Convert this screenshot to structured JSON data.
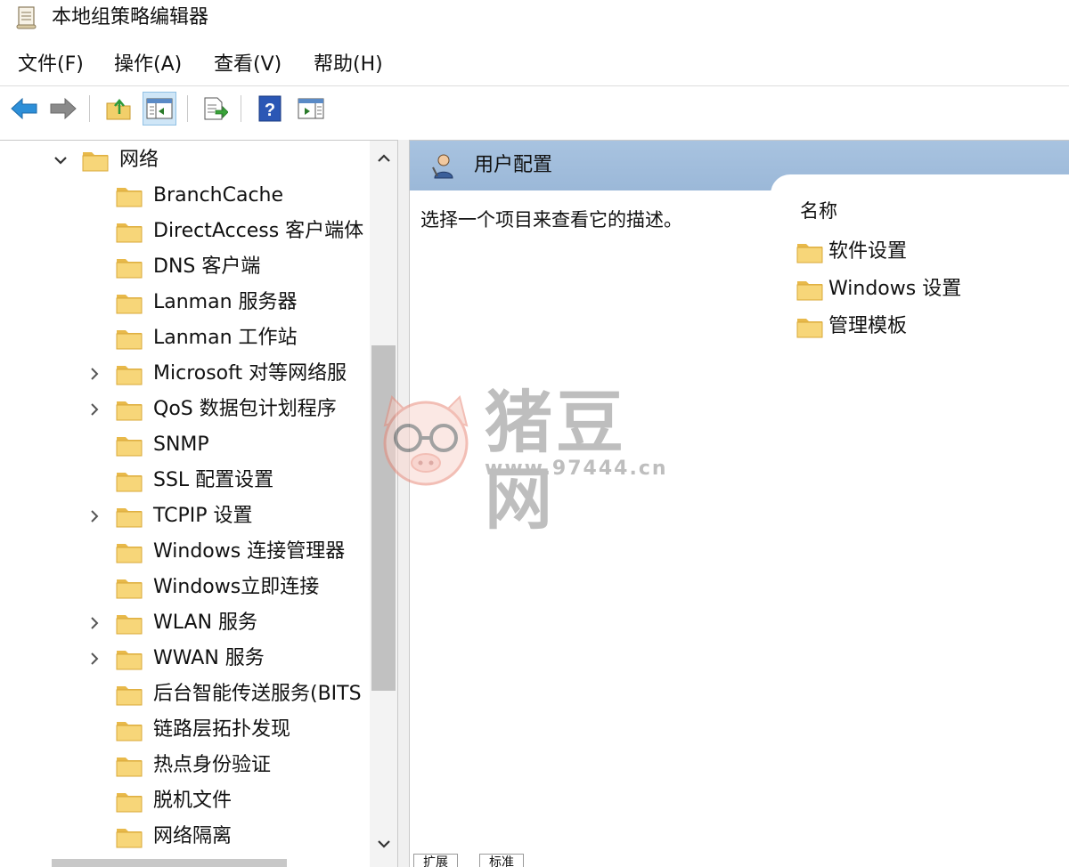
{
  "window": {
    "title": "本地组策略编辑器"
  },
  "menu": [
    {
      "label": "文件(F)"
    },
    {
      "label": "操作(A)"
    },
    {
      "label": "查看(V)"
    },
    {
      "label": "帮助(H)"
    }
  ],
  "toolbar": {
    "buttons": [
      "back-arrow-icon",
      "forward-arrow-icon",
      "up-folder-icon",
      "show-hide-tree-icon",
      "export-list-icon",
      "help-icon",
      "show-action-pane-icon"
    ],
    "active": "show-hide-tree-icon"
  },
  "tree": {
    "items": [
      {
        "label": "网络",
        "expander": "expanded"
      },
      {
        "label": "BranchCache",
        "expander": "none"
      },
      {
        "label": "DirectAccess 客户端体",
        "expander": "none"
      },
      {
        "label": "DNS 客户端",
        "expander": "none"
      },
      {
        "label": "Lanman 服务器",
        "expander": "none"
      },
      {
        "label": "Lanman 工作站",
        "expander": "none"
      },
      {
        "label": "Microsoft 对等网络服",
        "expander": "collapsed"
      },
      {
        "label": "QoS 数据包计划程序",
        "expander": "collapsed"
      },
      {
        "label": "SNMP",
        "expander": "none"
      },
      {
        "label": "SSL 配置设置",
        "expander": "none"
      },
      {
        "label": "TCPIP 设置",
        "expander": "collapsed"
      },
      {
        "label": "Windows 连接管理器",
        "expander": "none"
      },
      {
        "label": "Windows立即连接",
        "expander": "none"
      },
      {
        "label": "WLAN 服务",
        "expander": "collapsed"
      },
      {
        "label": "WWAN 服务",
        "expander": "collapsed"
      },
      {
        "label": "后台智能传送服务(BITS",
        "expander": "none"
      },
      {
        "label": "链路层拓扑发现",
        "expander": "none"
      },
      {
        "label": "热点身份验证",
        "expander": "none"
      },
      {
        "label": "脱机文件",
        "expander": "none"
      },
      {
        "label": "网络隔离",
        "expander": "none"
      }
    ]
  },
  "details": {
    "header_title": "用户配置",
    "description": "选择一个项目来查看它的描述。",
    "column_name": "名称",
    "items": [
      {
        "label": "软件设置"
      },
      {
        "label": "Windows 设置"
      },
      {
        "label": "管理模板"
      }
    ],
    "tabs": [
      "扩展",
      "标准"
    ]
  },
  "watermark": {
    "brand": "猪豆网",
    "url": "www.97444.cn"
  },
  "colors": {
    "header_blue": "#9fbcdb",
    "folder_yellow": "#f2cf6a",
    "selection": "#cfe6f7"
  }
}
